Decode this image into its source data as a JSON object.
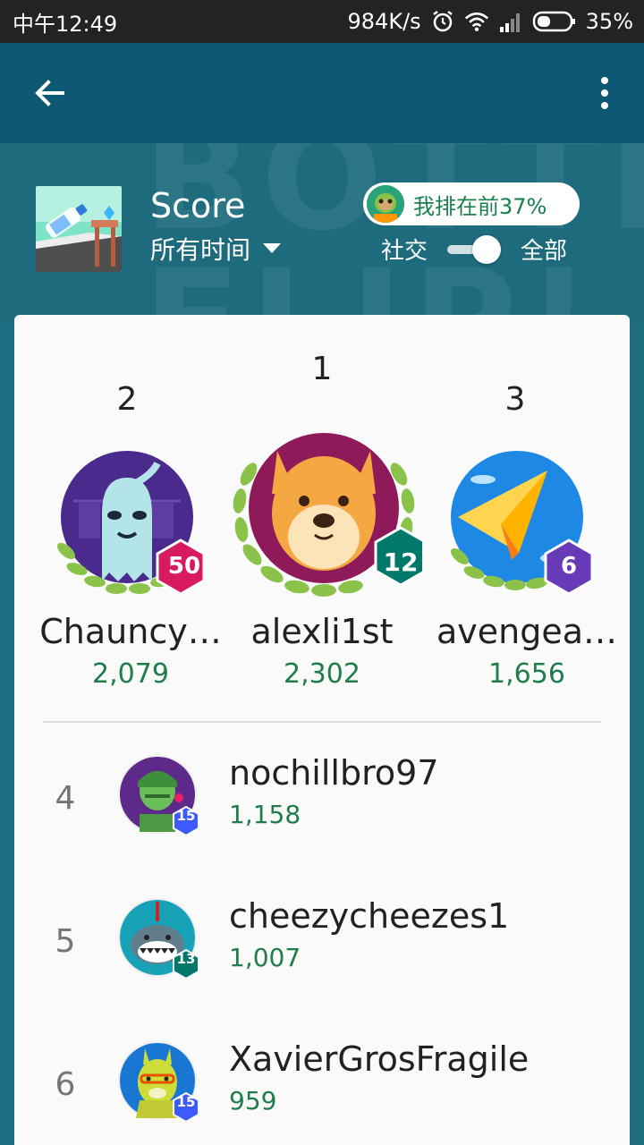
{
  "status_bar": {
    "time": "中午12:49",
    "speed": "984K/s",
    "battery": "35%",
    "icons": [
      "alarm-icon",
      "wifi-icon",
      "signal-icon",
      "battery-icon"
    ]
  },
  "app_bar": {
    "back_icon": "arrow-back-icon",
    "more_icon": "more-vert-icon"
  },
  "header": {
    "watermark": "BOTTLE FLIP!",
    "leaderboard_title": "Score",
    "time_filter": "所有时间",
    "rank_badge": "我排在前37%",
    "toggle_left": "社交",
    "toggle_right": "全部",
    "toggle_on": true
  },
  "podium": [
    {
      "rank": "2",
      "name": "Chauncy…",
      "score": "2,079",
      "level": "50",
      "level_color": "#d81b60"
    },
    {
      "rank": "1",
      "name": "alexli1st",
      "score": "2,302",
      "level": "12",
      "level_color": "#00796b"
    },
    {
      "rank": "3",
      "name": "avengea…",
      "score": "1,656",
      "level": "6",
      "level_color": "#673ab7"
    }
  ],
  "list": [
    {
      "rank": "4",
      "name": "nochillbro97",
      "score": "1,158",
      "level": "15",
      "level_color": "#3d5afe"
    },
    {
      "rank": "5",
      "name": "cheezycheezes1",
      "score": "1,007",
      "level": "13",
      "level_color": "#00796b"
    },
    {
      "rank": "6",
      "name": "XavierGrosFragile",
      "score": "959",
      "level": "15",
      "level_color": "#3d5afe"
    }
  ],
  "colors": {
    "app_bar": "#0f5873",
    "hero_bg": "#1d6b7d",
    "score_green": "#1e7d4a"
  }
}
